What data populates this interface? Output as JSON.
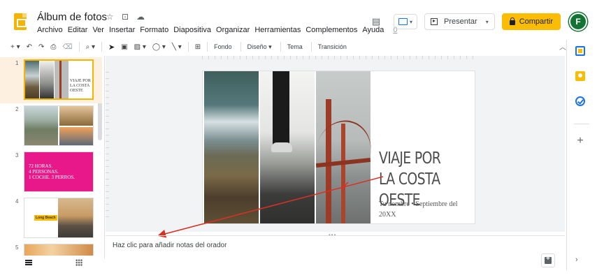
{
  "header": {
    "title": "Álbum de fotos",
    "title_icons": [
      "star-icon",
      "move-to-folder-icon",
      "cloud-saved-icon"
    ],
    "menu": [
      "Archivo",
      "Editar",
      "Ver",
      "Insertar",
      "Formato",
      "Diapositiva",
      "Organizar",
      "Herramientas",
      "Complementos",
      "Ayuda"
    ],
    "mic_label": "0",
    "present_label": "Presentar",
    "share_label": "Compartir",
    "avatar_initial": "F",
    "colors": {
      "share": "#fbbc04",
      "avatar": "#137333",
      "logo": "#f4b400"
    }
  },
  "toolbar": {
    "fondo": "Fondo",
    "diseno": "Diseño ▾",
    "tema": "Tema",
    "transicion": "Transición",
    "icons": [
      "new-slide-icon",
      "undo-icon",
      "redo-icon",
      "print-icon",
      "paint-format-icon",
      "zoom-icon",
      "select-icon",
      "textbox-icon",
      "image-icon",
      "shape-icon",
      "line-icon",
      "comment-icon"
    ]
  },
  "filmstrip": {
    "slides": [
      {
        "number": "1",
        "caption": "VIAJE POR LA COSTA OESTE"
      },
      {
        "number": "2"
      },
      {
        "number": "3",
        "line1": "72 HORAS.",
        "line2": "4 PERSONAS.",
        "line3": "1 COCHE. 3 PERROS."
      },
      {
        "number": "4",
        "badge": "Long Beach"
      },
      {
        "number": "5"
      }
    ]
  },
  "slide": {
    "title": "VIAJE POR LA COSTA OESTE",
    "subtitle": "Tu nombre • Septiembre del 20XX"
  },
  "notes": {
    "placeholder": "Haz clic para añadir notas del orador"
  },
  "sidepanel": {
    "icons": [
      "calendar-icon",
      "keep-icon",
      "tasks-icon",
      "add-icon",
      "expand-icon"
    ]
  }
}
